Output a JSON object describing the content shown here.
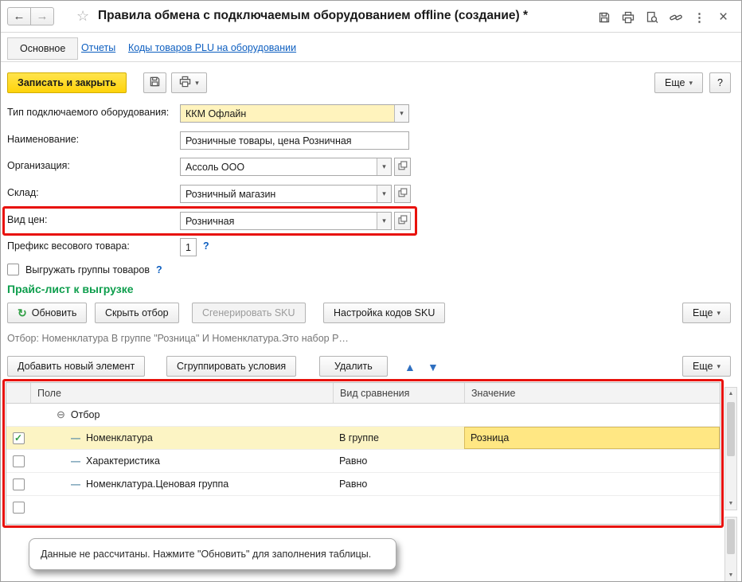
{
  "colors": {
    "accent_yellow": "#FFD30A",
    "annotation_red": "#E8120C",
    "section_green": "#0E9E4D",
    "link_blue": "#0E5FC0",
    "required_field_bg": "#FFF3BD",
    "selected_row_bg": "#FCF4C4",
    "selected_cell_bg": "#FFE783"
  },
  "glyphs": {
    "back": "←",
    "forward": "→",
    "star": "☆",
    "dots": "⋮",
    "close": "×",
    "caret_down": "▾",
    "refresh": "↻",
    "up": "▲",
    "down": "▼",
    "collapse": "⊖",
    "dash": "—",
    "check": "✓",
    "help": "?"
  },
  "titlebar": {
    "title": "Правила обмена с подключаемым оборудованием offline (создание) *"
  },
  "tabs": {
    "main": "Основное",
    "reports": "Отчеты",
    "plu": "Коды товаров PLU на оборудовании"
  },
  "toolbar": {
    "save_close": "Записать и закрыть",
    "more": "Еще",
    "help": "?"
  },
  "form": {
    "equipment_type_label": "Тип подключаемого оборудования:",
    "equipment_type_value": "ККМ Офлайн",
    "name_label": "Наименование:",
    "name_value": "Розничные товары, цена Розничная",
    "organization_label": "Организация:",
    "organization_value": "Ассоль ООО",
    "warehouse_label": "Склад:",
    "warehouse_value": "Розничный магазин",
    "price_type_label": "Вид цен:",
    "price_type_value": "Розничная",
    "weight_prefix_label": "Префикс весового товара:",
    "weight_prefix_value": "1",
    "export_groups_label": "Выгружать группы товаров"
  },
  "price_list": {
    "section_title": "Прайс-лист к выгрузке",
    "refresh": "Обновить",
    "hide_filter": "Скрыть отбор",
    "generate_sku": "Сгенерировать SKU",
    "sku_settings": "Настройка кодов SKU",
    "more": "Еще",
    "filter_summary": "Отбор: Номенклатура В группе \"Розница\" И Номенклатура.Это набор Р…"
  },
  "filter_editor": {
    "add_item": "Добавить новый элемент",
    "group_conditions": "Сгруппировать условия",
    "delete": "Удалить",
    "more": "Еще",
    "columns": {
      "field": "Поле",
      "comparison": "Вид сравнения",
      "value": "Значение"
    },
    "group_label": "Отбор",
    "rows": [
      {
        "checked": true,
        "field": "Номенклатура",
        "comparison": "В группе",
        "value": "Розница"
      },
      {
        "checked": false,
        "field": "Характеристика",
        "comparison": "Равно",
        "value": ""
      },
      {
        "checked": false,
        "field": "Номенклатура.Ценовая группа",
        "comparison": "Равно",
        "value": ""
      }
    ]
  },
  "footer": {
    "message": "Данные не рассчитаны. Нажмите \"Обновить\" для заполнения таблицы."
  }
}
